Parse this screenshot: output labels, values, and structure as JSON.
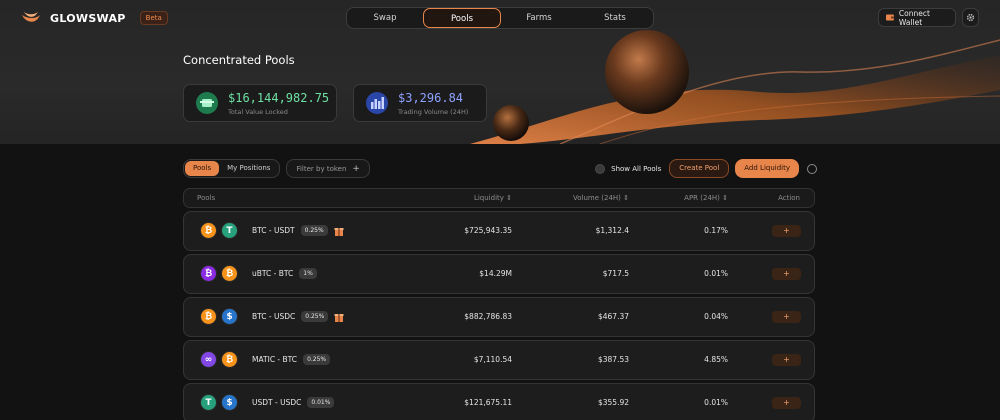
{
  "header": {
    "brand": "GLOWSWAP",
    "beta": "Beta",
    "nav": [
      "Swap",
      "Pools",
      "Farms",
      "Stats"
    ],
    "active_nav": "Pools",
    "connect": "Connect Wallet"
  },
  "hero": {
    "title": "Concentrated Pools",
    "tvl_value": "$16,144,982.75",
    "tvl_label": "Total Value Locked",
    "vol_value": "$3,296.84",
    "vol_label": "Trading Volume (24H)"
  },
  "toolbar": {
    "tab_pools": "Pools",
    "tab_positions": "My Positions",
    "filter": "Filter by token",
    "show_all": "Show All Pools",
    "create": "Create Pool",
    "add": "Add Liquidity"
  },
  "table": {
    "headers": {
      "pools": "Pools",
      "liquidity": "Liquidity ⇕",
      "volume": "Volume (24H) ⇕",
      "apr": "APR (24H) ⇕",
      "action": "Action"
    },
    "rows": [
      {
        "pair": "BTC - USDT",
        "fee": "0.25%",
        "liquidity": "$725,943.35",
        "volume": "$1,312.4",
        "apr": "0.17%",
        "action": "+",
        "gift": true
      },
      {
        "pair": "uBTC - BTC",
        "fee": "1%",
        "liquidity": "$14.29M",
        "volume": "$717.5",
        "apr": "0.01%",
        "action": "+",
        "gift": false
      },
      {
        "pair": "BTC - USDC",
        "fee": "0.25%",
        "liquidity": "$882,786.83",
        "volume": "$467.37",
        "apr": "0.04%",
        "action": "+",
        "gift": true
      },
      {
        "pair": "MATIC - BTC",
        "fee": "0.25%",
        "liquidity": "$7,110.54",
        "volume": "$387.53",
        "apr": "4.85%",
        "action": "+",
        "gift": false
      },
      {
        "pair": "USDT - USDC",
        "fee": "0.01%",
        "liquidity": "$121,675.11",
        "volume": "$355.92",
        "apr": "0.01%",
        "action": "+",
        "gift": false
      }
    ]
  },
  "colors": {
    "accent": "#e8854a",
    "tvl": "#6ee0a3",
    "volume": "#8ea2ff",
    "btc": "#f7931a",
    "usdt": "#26a17b",
    "usdc": "#2775ca",
    "matic": "#8247e5"
  },
  "icons": {
    "btc": "bitcoin-icon",
    "usdt": "tether-icon",
    "usdc": "usdc-icon",
    "ubtc": "ubtc-icon",
    "matic": "polygon-icon"
  }
}
